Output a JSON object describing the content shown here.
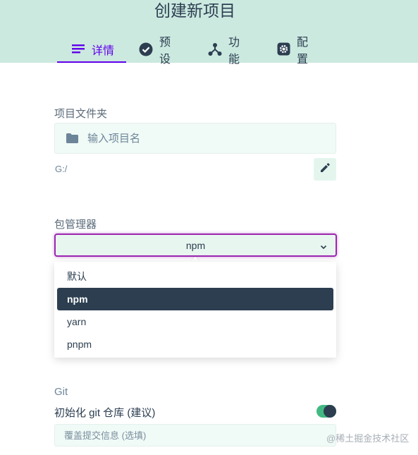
{
  "page": {
    "title": "创建新项目"
  },
  "tabs": [
    {
      "label": "详情",
      "icon": "list-icon",
      "active": true
    },
    {
      "label": "预设",
      "icon": "check-circle-icon"
    },
    {
      "label": "功能",
      "icon": "share-icon"
    },
    {
      "label": "配置",
      "icon": "gear-icon"
    }
  ],
  "project_folder": {
    "label": "项目文件夹",
    "placeholder": "输入项目名",
    "path": "G:/"
  },
  "package_manager": {
    "label": "包管理器",
    "selected": "npm",
    "options": [
      "默认",
      "npm",
      "yarn",
      "pnpm"
    ]
  },
  "git": {
    "label": "Git",
    "init_label": "初始化 git 仓库 (建议)",
    "init_enabled": true,
    "commit_placeholder": "覆盖提交信息 (选填)"
  },
  "watermark": "@稀土掘金技术社区",
  "colors": {
    "header_bg": "#cce9e0",
    "active_tab": "#6200ea",
    "selected_option_bg": "#2c3e50",
    "toggle_on": "#42b983"
  }
}
